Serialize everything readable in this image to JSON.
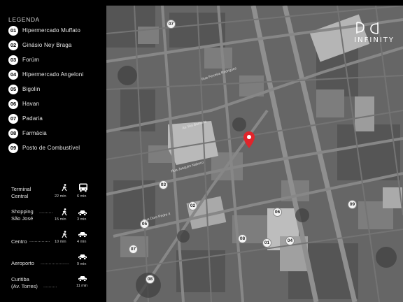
{
  "legend": {
    "title": "LEGENDA",
    "items": [
      {
        "num": "01",
        "label": "Hipermercado Muffato"
      },
      {
        "num": "02",
        "label": "Ginásio Ney Braga"
      },
      {
        "num": "03",
        "label": "Forúm"
      },
      {
        "num": "04",
        "label": "Hipermercado Angeloni"
      },
      {
        "num": "05",
        "label": "Bigolin"
      },
      {
        "num": "06",
        "label": "Havan"
      },
      {
        "num": "07",
        "label": "Padaria"
      },
      {
        "num": "08",
        "label": "Farmácia"
      },
      {
        "num": "09",
        "label": "Posto de Combustível"
      }
    ]
  },
  "routes": [
    {
      "name_1": "Terminal",
      "name_2": "Central",
      "walk_time": "22 min",
      "vehicle_time": "6 min",
      "vehicle_icon": "bus-icon"
    },
    {
      "name_1": "Shopping",
      "name_2": "São José",
      "walk_time": "15 min",
      "vehicle_time": "3 min",
      "vehicle_icon": "car-icon"
    },
    {
      "name_1": "Centro",
      "name_2": "",
      "walk_time": "10 min",
      "vehicle_time": "4 min",
      "vehicle_icon": "car-icon"
    },
    {
      "name_1": "Aeroporto",
      "name_2": "",
      "walk_time": "",
      "vehicle_time": "9 min",
      "vehicle_icon": "car-icon"
    },
    {
      "name_1": "Curitiba",
      "name_2": "(Av. Torres)",
      "walk_time": "",
      "vehicle_time": "11 min",
      "vehicle_icon": "car-icon"
    }
  ],
  "map": {
    "brand": "INFINITY",
    "pin_color": "#e0252b",
    "pins": [
      "01",
      "02",
      "03",
      "04",
      "05",
      "06",
      "07",
      "08",
      "09",
      "07",
      "08"
    ],
    "streets": [
      "Rua Ferreira Rodrigues",
      "Av. Rui Barbosa",
      "Rua Joaquim Nabuco",
      "Rua Dom Pedro II"
    ]
  }
}
